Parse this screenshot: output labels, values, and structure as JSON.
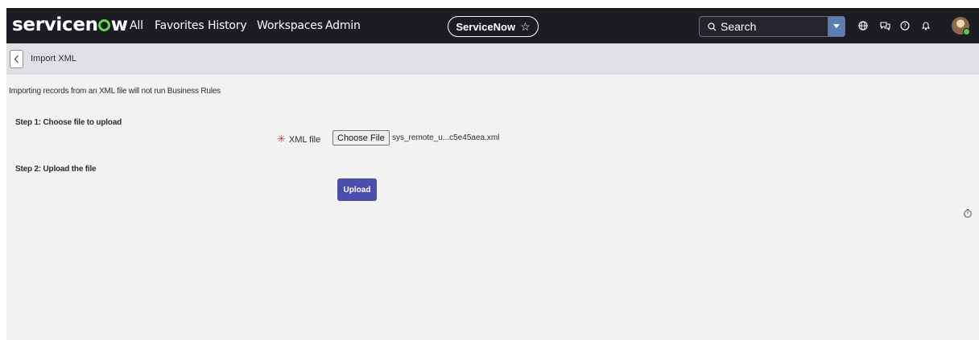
{
  "nav": {
    "logo_pre": "servicen",
    "logo_post": "w",
    "links": [
      "All",
      "Favorites",
      "History",
      "Workspaces",
      "Admin"
    ],
    "scope_pill": "ServiceNow",
    "search_placeholder": "Search",
    "icons": [
      "globe-icon",
      "chat-icon",
      "help-icon",
      "bell-icon"
    ]
  },
  "subheader": {
    "title": "Import XML"
  },
  "content": {
    "notice": "Importing records from an XML file will not run Business Rules",
    "step1": "Step 1: Choose file to upload",
    "required_marker": "✳",
    "field_label": "XML file",
    "choose_file_label": "Choose File",
    "file_name": "sys_remote_u...c5e45aea.xml",
    "step2": "Step 2: Upload the file",
    "upload_label": "Upload"
  },
  "colors": {
    "nav_bg": "#1c1c23",
    "brand_green": "#62d84e",
    "upload_button": "#4a4fad",
    "required": "#c8404b"
  }
}
